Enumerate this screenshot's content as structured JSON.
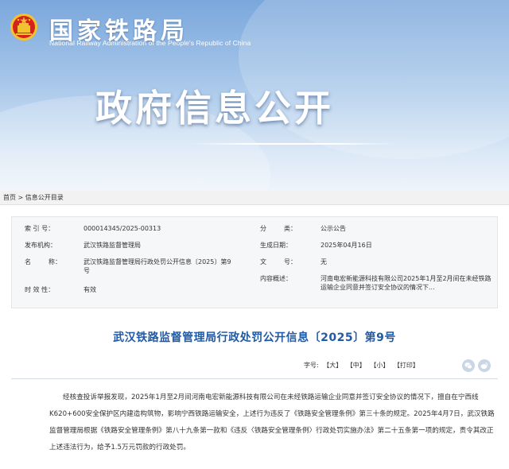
{
  "header": {
    "org_name": "国家铁路局",
    "org_name_en": "National Railway Administration of the People's Republic of China",
    "banner_title": "政府信息公开",
    "emblem_icon": "national-emblem-icon"
  },
  "breadcrumb": {
    "home": "首页",
    "separator": " > ",
    "current": "信息公开目录"
  },
  "info": {
    "index_label": "索 引 号：",
    "index_value": "000014345/2025-00313",
    "category_label": [
      "分",
      "类："
    ],
    "category_value": "公示公告",
    "publisher_label": "发布机构：",
    "publisher_value": "武汉铁路监督管理局",
    "date_label": "生成日期：",
    "date_value": "2025年04月16日",
    "name_label": [
      "名",
      "称："
    ],
    "name_value": "武汉铁路监督管理局行政处罚公开信息〔2025〕第9号",
    "docno_label": [
      "文",
      "号："
    ],
    "docno_value": "无",
    "summary_label": "内容概述：",
    "summary_value": "河南电宏新能源科技有限公司2025年1月至2月间在未经铁路运输企业同意并签订安全协议的情况下...",
    "validity_label": "时 效 性：",
    "validity_value": "有效"
  },
  "article": {
    "title": "武汉铁路监督管理局行政处罚公开信息〔2025〕第9号",
    "font_size_label": "字号:",
    "font_large": "【大】",
    "font_medium": "【中】",
    "font_small": "【小】",
    "print": "【打印】",
    "share_icons": [
      "wechat-share-icon",
      "weibo-share-icon"
    ],
    "paragraph": "经核查投诉举报发现，2025年1月至2月间河南电宏新能源科技有限公司在未经铁路运输企业同意并签订安全协议的情况下，擅自在宁西线K620+600安全保护区内建造构筑物，影响宁西铁路运输安全，上述行为违反了《铁路安全管理条例》第三十条的规定。2025年4月7日，武汉铁路监督管理局根据《铁路安全管理条例》第八十九条第一款和《违反〈铁路安全管理条例〉行政处罚实施办法》第二十五条第一项的规定，责令其改正上述违法行为，给予1.5万元罚款的行政处罚。"
  },
  "colors": {
    "title_blue": "#1f5aa6",
    "banner_top": "#7aa7dc",
    "emblem_red": "#d4231a",
    "emblem_gold": "#f2c230"
  }
}
